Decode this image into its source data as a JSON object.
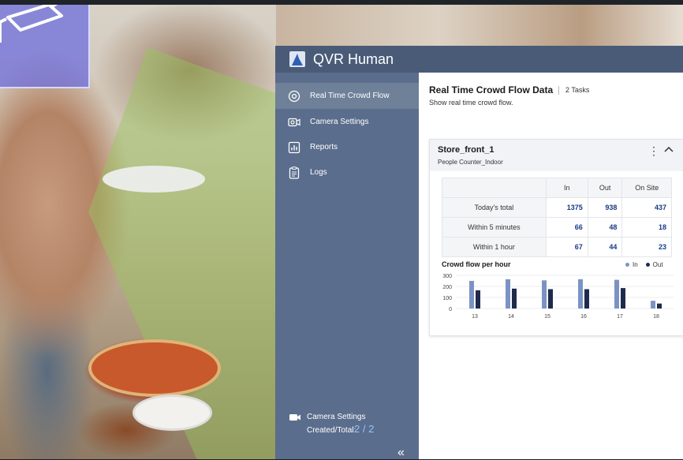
{
  "app": {
    "title": "QVR Human"
  },
  "sidebar": {
    "items": [
      {
        "label": "Real Time Crowd Flow",
        "icon": "target-icon",
        "active": true
      },
      {
        "label": "Camera Settings",
        "icon": "camera-icon",
        "active": false
      },
      {
        "label": "Reports",
        "icon": "chart-icon",
        "active": false
      },
      {
        "label": "Logs",
        "icon": "clipboard-icon",
        "active": false
      }
    ],
    "footer": {
      "label": "Camera Settings",
      "count_label": "Created/Total:",
      "count": "2 / 2",
      "collapse": "«"
    }
  },
  "main": {
    "title": "Real Time Crowd Flow Data",
    "tasks": "2 Tasks",
    "subtitle": "Show real time crowd flow."
  },
  "card": {
    "title": "Store_front_1",
    "subtitle": "People Counter_Indoor",
    "menu": "⋮",
    "table": {
      "headers": [
        "",
        "In",
        "Out",
        "On Site"
      ],
      "rows": [
        {
          "label": "Today's total",
          "in": "1375",
          "out": "938",
          "onsite": "437"
        },
        {
          "label": "Within 5 minutes",
          "in": "66",
          "out": "48",
          "onsite": "18"
        },
        {
          "label": "Within 1 hour",
          "in": "67",
          "out": "44",
          "onsite": "23"
        }
      ]
    }
  },
  "chart_data": {
    "type": "bar",
    "title": "Crowd flow per hour",
    "categories": [
      "13",
      "14",
      "15",
      "16",
      "17",
      "18"
    ],
    "series": [
      {
        "name": "In",
        "values": [
          250,
          265,
          255,
          265,
          260,
          70
        ],
        "color": "#7b93c4"
      },
      {
        "name": "Out",
        "values": [
          165,
          180,
          175,
          175,
          185,
          45
        ],
        "color": "#1f2b4d"
      }
    ],
    "yticks": [
      "300",
      "200",
      "100",
      "0"
    ],
    "ylim": [
      0,
      300
    ],
    "legend": "top-right"
  },
  "colors": {
    "header": "#4a5b78",
    "sidebar": "#5b6d8c",
    "accent": "#8fc4ff",
    "value": "#173a86"
  }
}
